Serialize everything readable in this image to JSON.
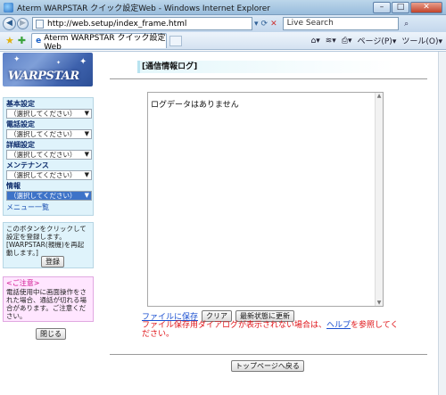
{
  "window": {
    "title": "Aterm WARPSTAR クイック設定Web - Windows Internet Explorer",
    "minimize": "–",
    "maximize": "□",
    "close": "✕"
  },
  "address": {
    "url": "http://web.setup/index_frame.html",
    "search_placeholder": "Live Search"
  },
  "tab": {
    "label": "Aterm WARPSTAR クイック設定Web"
  },
  "command_bar": {
    "page_label": "ページ(P)",
    "tools_label": "ツール(O)"
  },
  "sidebar": {
    "logo_text": "WARPSTAR",
    "menus": [
      {
        "label": "基本設定",
        "value": "（選択してください）"
      },
      {
        "label": "電話設定",
        "value": "（選択してください）"
      },
      {
        "label": "詳細設定",
        "value": "（選択してください）"
      },
      {
        "label": "メンテナンス",
        "value": "（選択してください）"
      },
      {
        "label": "情報",
        "value": "（選択してください）"
      }
    ],
    "menu_all": "メニュー一覧",
    "register_text": "このボタンをクリックして設定を登録します。[WARPSTAR(親機)を再起動します。]",
    "register_button": "登録",
    "notice_title": "<ご注意>",
    "notice_text": "電話使用中に画面操作をされた場合、通話が切れる場合があります。ご注意ください。",
    "close_button": "閉じる"
  },
  "main": {
    "heading": "[通信情報ログ]",
    "log_text": "ログデータはありません",
    "save_link": "ファイルに保存",
    "clear_button": "クリア",
    "refresh_button": "最新状態に更新",
    "error_before": "ファイル保存用ダイアログが表示されない場合は、",
    "error_help": "ヘルプ",
    "error_after": "を参照してください。",
    "top_button": "トップページへ戻る"
  }
}
